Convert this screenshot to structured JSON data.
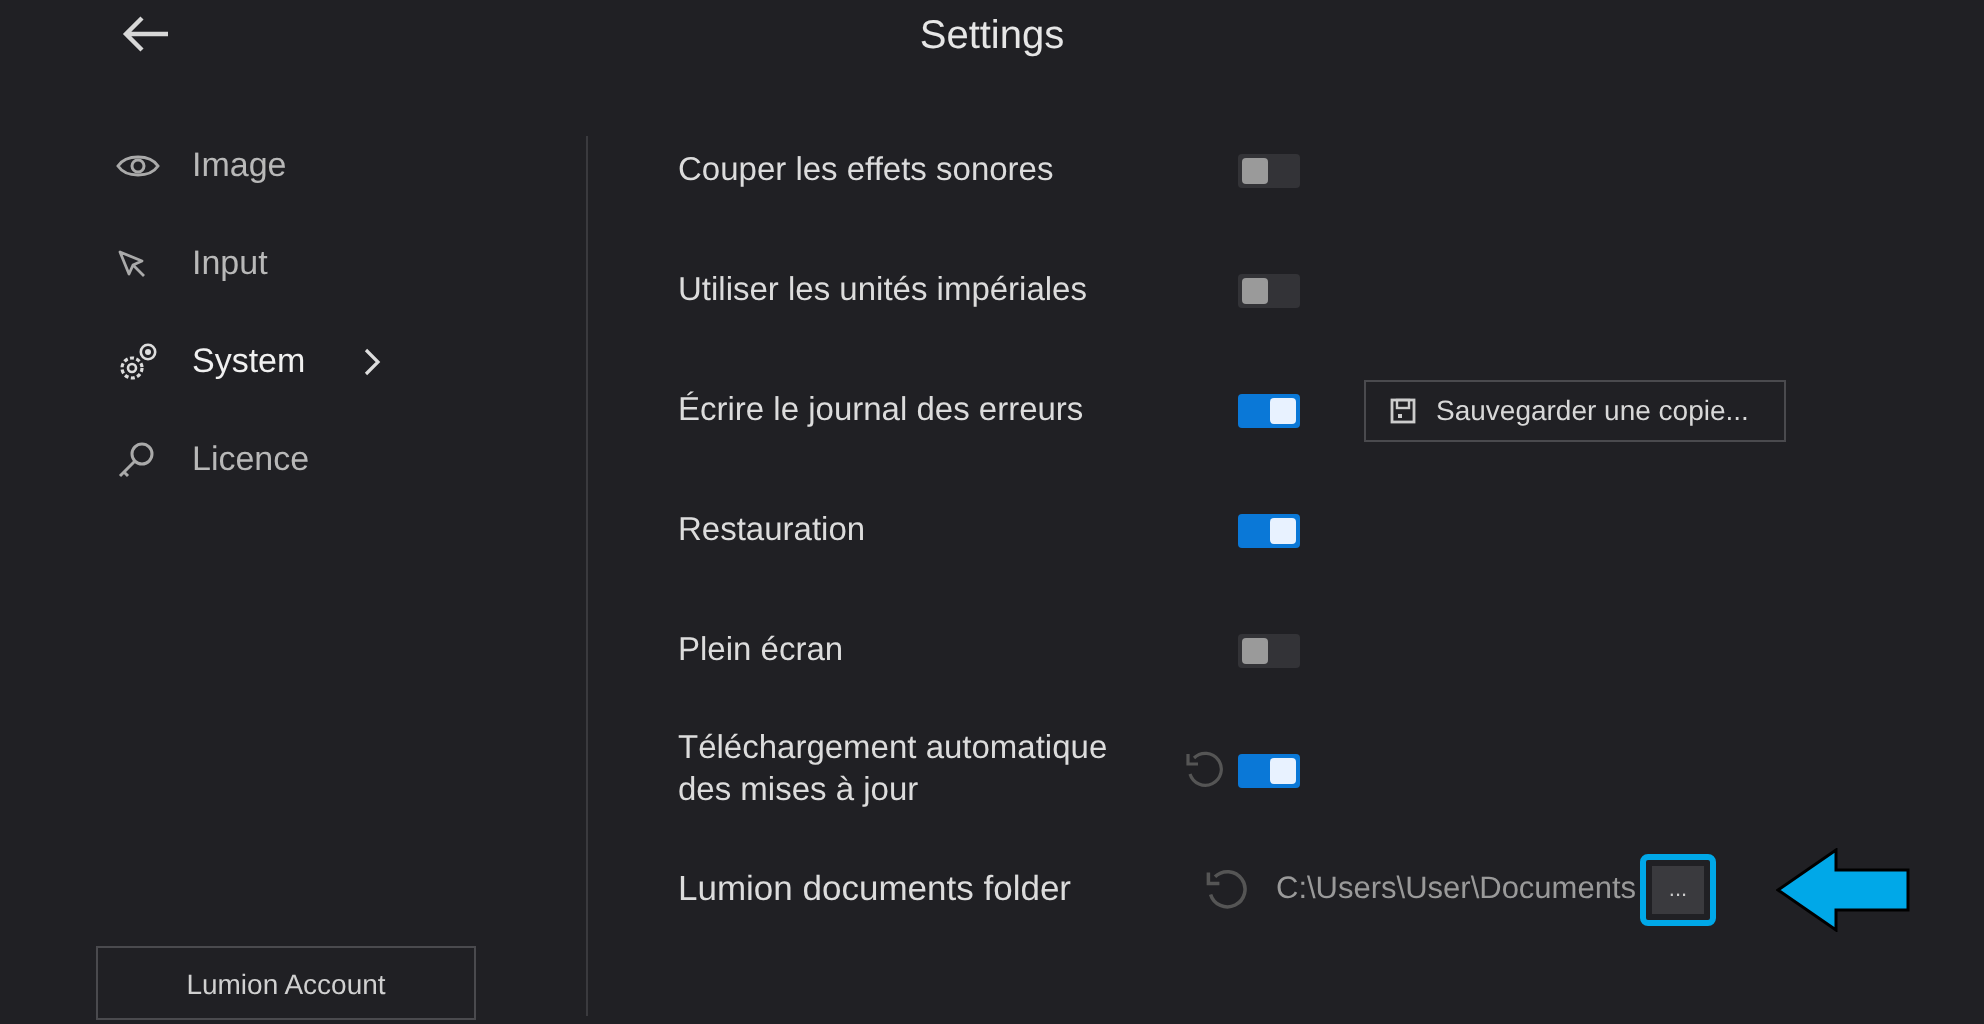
{
  "header": {
    "title": "Settings"
  },
  "sidebar": {
    "items": [
      {
        "label": "Image",
        "selected": false
      },
      {
        "label": "Input",
        "selected": false
      },
      {
        "label": "System",
        "selected": true
      },
      {
        "label": "Licence",
        "selected": false
      }
    ],
    "account_button": "Lumion Account"
  },
  "settings": [
    {
      "kind": "toggle",
      "label": "Couper les effets sonores",
      "on": false,
      "reset": false
    },
    {
      "kind": "toggle",
      "label": "Utiliser les unités impériales",
      "on": false,
      "reset": false
    },
    {
      "kind": "toggle",
      "label": "Écrire le journal des erreurs",
      "on": true,
      "reset": false,
      "action": "Sauvegarder une copie..."
    },
    {
      "kind": "toggle",
      "label": "Restauration",
      "on": true,
      "reset": false
    },
    {
      "kind": "toggle",
      "label": "Plein écran",
      "on": false,
      "reset": false
    },
    {
      "kind": "toggle",
      "label": "Téléchargement automatique des mises à jour",
      "on": true,
      "reset": true
    },
    {
      "kind": "folder",
      "label": "Lumion documents folder",
      "reset": true,
      "path": "C:\\Users\\User\\Documents",
      "browse": "...",
      "highlighted": true
    }
  ]
}
